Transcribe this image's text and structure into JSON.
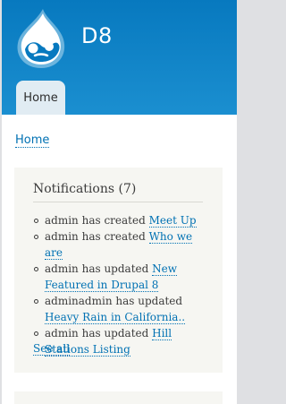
{
  "site": {
    "name": "D8"
  },
  "nav": {
    "tabs": [
      {
        "label": "Home"
      }
    ]
  },
  "breadcrumb": {
    "items": [
      {
        "label": "Home"
      }
    ]
  },
  "notifications": {
    "title": "Notifications (7)",
    "items": [
      {
        "text": "admin has created ",
        "link": "Meet Up"
      },
      {
        "text": "admin has created ",
        "link": "Who we are"
      },
      {
        "text": "admin has updated ",
        "link": "New Featured in Drupal 8"
      },
      {
        "text": "adminadmin has updated ",
        "link": "Heavy Rain in California.."
      },
      {
        "text": "admin has updated ",
        "link": "Hill Stations Listing"
      }
    ],
    "see_all": "See all"
  },
  "colors": {
    "header": "#0779bf",
    "link": "#0071b3",
    "tab_active": "#e1ecf3",
    "block_bg": "#f6f6f2"
  }
}
